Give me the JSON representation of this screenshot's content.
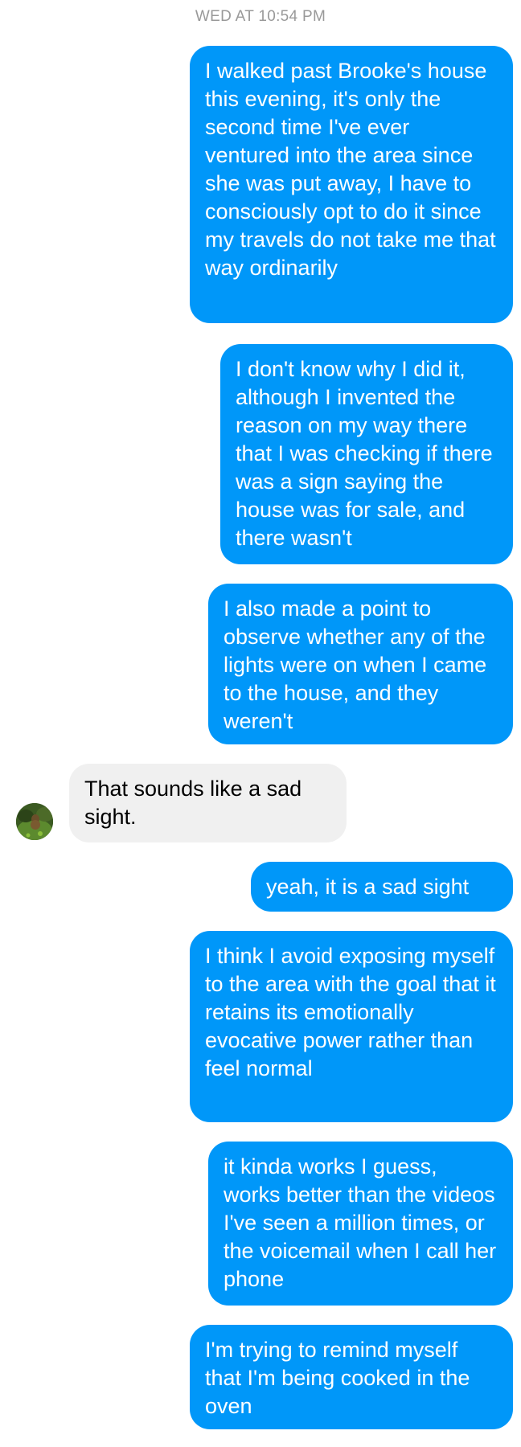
{
  "conversation": {
    "timestamp": "WED AT 10:54 PM",
    "messages": [
      {
        "sender": "me",
        "text": "I walked past Brooke's house this evening, it's only the second time I've ever ventured into the area since she was put away, I have to consciously opt to do it since my travels do not take me that way ordinarily"
      },
      {
        "sender": "me",
        "text": "I don't know why I did it, although I invented the reason on my way there that I was checking if there was a sign saying the house was for sale, and there wasn't"
      },
      {
        "sender": "me",
        "text": "I also made a point to observe whether any of the lights were on when I came to the house, and they weren't"
      },
      {
        "sender": "them",
        "text": "That sounds like a sad sight."
      },
      {
        "sender": "me",
        "text": "yeah, it is a sad sight"
      },
      {
        "sender": "me",
        "text": "I think I avoid exposing myself to the area with the goal that it retains its emotionally evocative power rather than feel normal"
      },
      {
        "sender": "me",
        "text": "it kinda works I guess, works better than the videos I've seen a million times, or the voicemail when I call her phone"
      },
      {
        "sender": "me",
        "text": "I'm trying to remind myself that I'm being cooked in the oven"
      }
    ]
  },
  "colors": {
    "outgoing_bubble": "#0097f9",
    "incoming_bubble": "#f0f0f0",
    "timestamp_text": "#999999"
  },
  "icons": {
    "avatar": "contact-avatar"
  }
}
